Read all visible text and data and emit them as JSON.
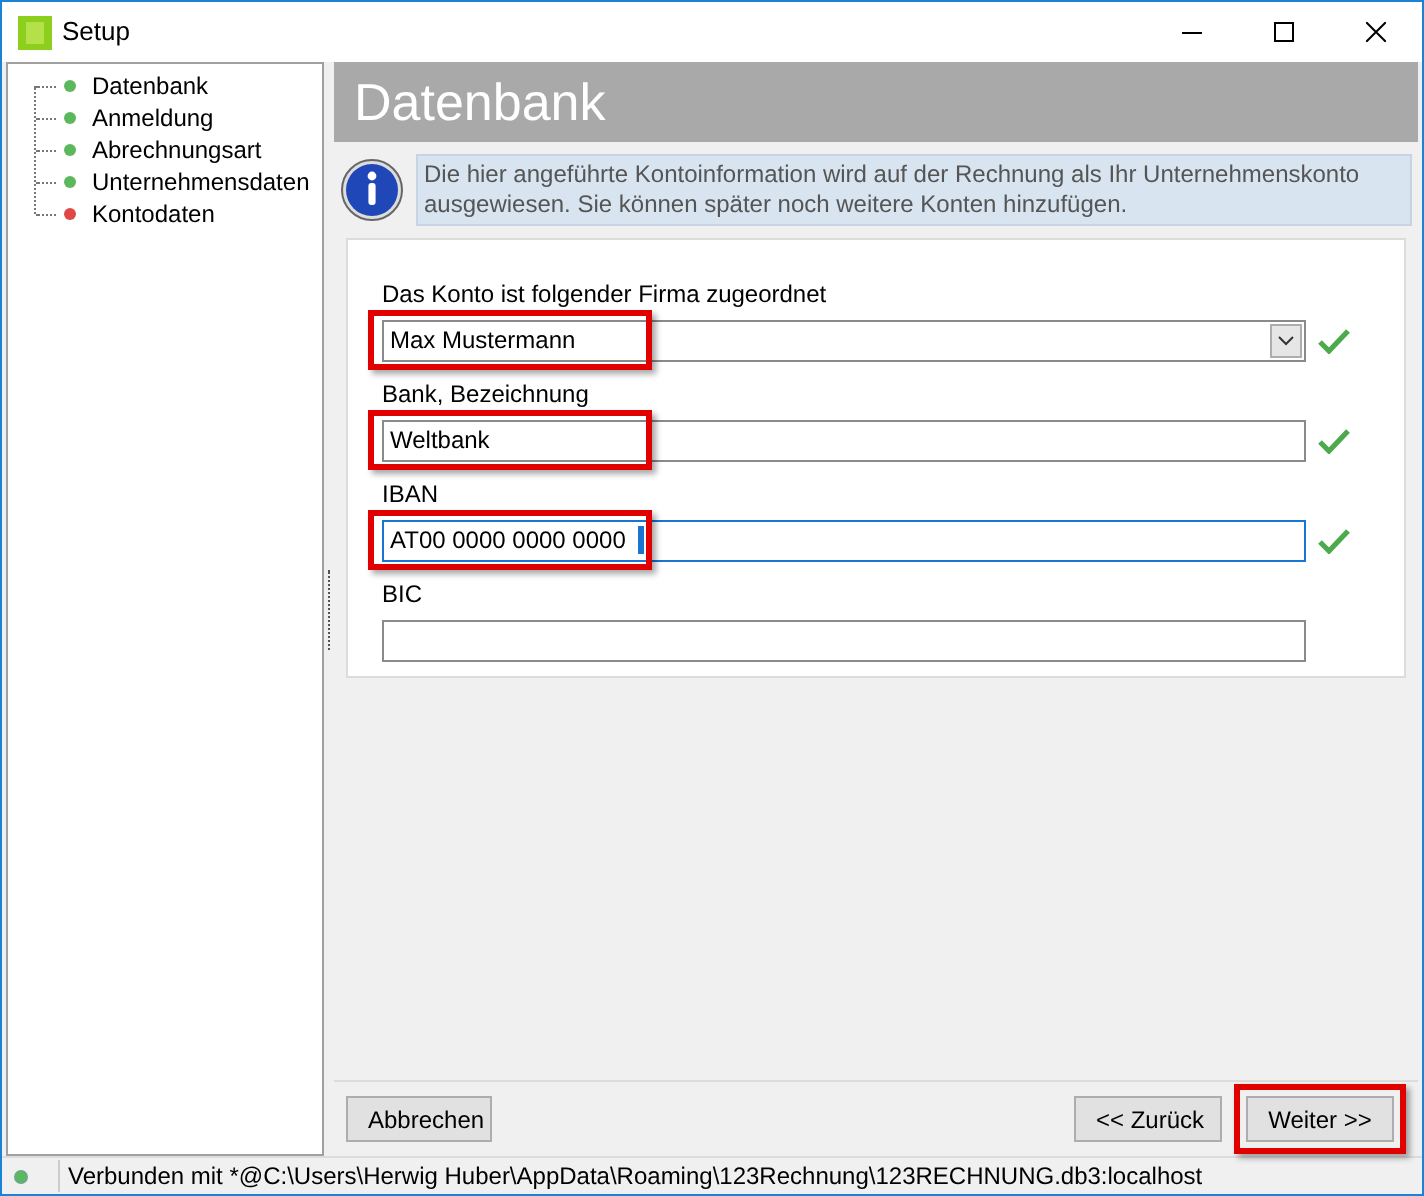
{
  "window": {
    "title": "Setup"
  },
  "sidebar": {
    "items": [
      {
        "label": "Datenbank",
        "color": "#5cb85c"
      },
      {
        "label": "Anmeldung",
        "color": "#5cb85c"
      },
      {
        "label": "Abrechnungsart",
        "color": "#5cb85c"
      },
      {
        "label": "Unternehmensdaten",
        "color": "#5cb85c"
      },
      {
        "label": "Kontodaten",
        "color": "#e04848"
      }
    ]
  },
  "header": {
    "title": "Datenbank"
  },
  "info": {
    "text": "Die hier angeführte Kontoinformation wird auf der Rechnung als Ihr Unternehmenskonto ausgewiesen. Sie können später noch weitere Konten hinzufügen."
  },
  "form": {
    "fields": [
      {
        "kind": "combo",
        "label": "Das Konto ist folgender Firma zugeordnet",
        "value": "Max Mustermann",
        "valid": true,
        "focused": false,
        "highlighted": true
      },
      {
        "kind": "text",
        "label": "Bank, Bezeichnung",
        "value": "Weltbank",
        "valid": true,
        "focused": false,
        "highlighted": true
      },
      {
        "kind": "text",
        "label": "IBAN",
        "value": "AT00 0000 0000 0000",
        "valid": true,
        "focused": true,
        "highlighted": true
      },
      {
        "kind": "text",
        "label": "BIC",
        "valid": false,
        "focused": false,
        "highlighted": false
      }
    ]
  },
  "buttons": [
    {
      "label": "Abbrechen",
      "highlighted": false
    },
    {
      "label": "<< Zurück",
      "highlighted": false
    },
    {
      "label": "Weiter >>",
      "highlighted": true
    }
  ],
  "status_bar": {
    "text": "Verbunden mit *@C:\\Users\\Herwig Huber\\AppData\\Roaming\\123Rechnung\\123RECHNUNG.db3:localhost"
  }
}
